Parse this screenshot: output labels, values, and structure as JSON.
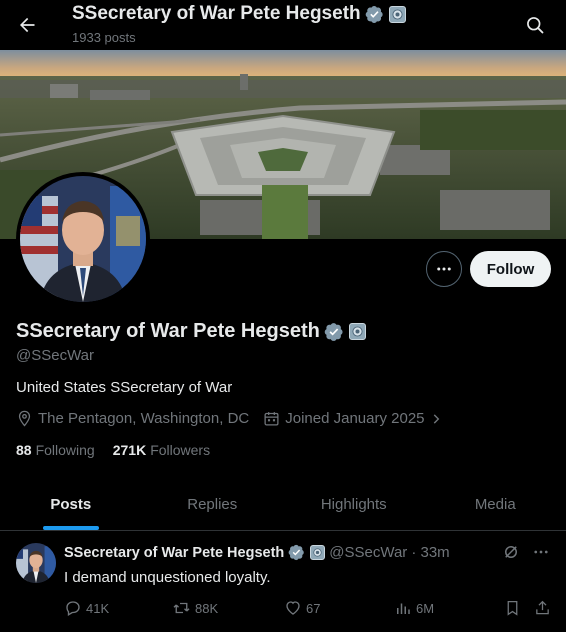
{
  "header": {
    "title": "SSecretary of War Pete Hegseth",
    "post_count": "1933 posts",
    "back_icon": "arrow-left-icon",
    "search_icon": "search-icon"
  },
  "profile": {
    "name": "SSecretary of War Pete Hegseth",
    "handle": "@SSecWar",
    "bio": "United States SSecretary of War",
    "location": "The Pentagon, Washington, DC",
    "joined": "Joined January 2025",
    "following_count": "88",
    "following_label": "Following",
    "followers_count": "271K",
    "followers_label": "Followers",
    "follow_label": "Follow",
    "verified_color": "#829aab"
  },
  "tabs": [
    {
      "label": "Posts",
      "active": true
    },
    {
      "label": "Replies",
      "active": false
    },
    {
      "label": "Highlights",
      "active": false
    },
    {
      "label": "Media",
      "active": false
    }
  ],
  "tweet": {
    "name": "SSecretary of War Pete Hegseth",
    "handle": "@SSecWar",
    "time": "· 33m",
    "text": "I demand unquestioned loyalty.",
    "replies": "41K",
    "reposts": "88K",
    "likes": "67",
    "views": "6M"
  },
  "colors": {
    "accent": "#1d9bf0",
    "muted": "#71767b",
    "text": "#e7e9ea",
    "border": "#2f3336"
  }
}
